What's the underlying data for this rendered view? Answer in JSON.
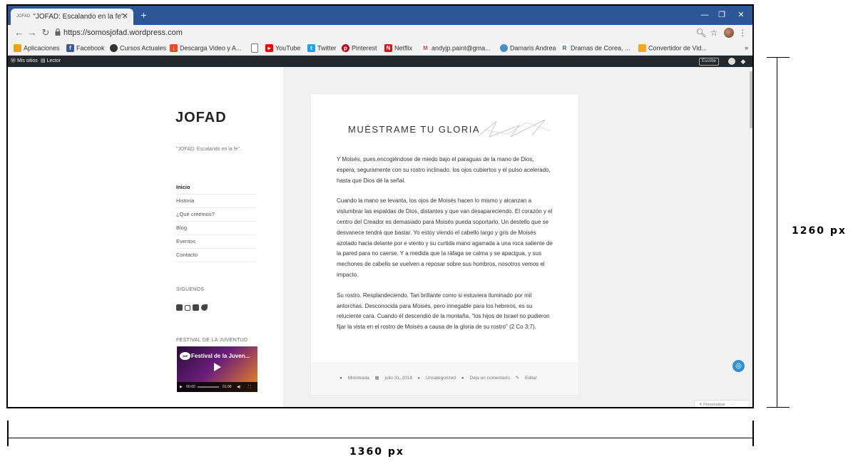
{
  "browser": {
    "tab_title": "\"JOFAD: Escalando en la fe\".",
    "tab_favicon_text": "JOFAD",
    "new_tab_label": "+",
    "url": "https://somosjofad.wordpress.com"
  },
  "bookmarks": [
    {
      "label": "Aplicaciones",
      "color": "#e8a41a",
      "icon": "apps-icon"
    },
    {
      "label": "Facebook",
      "color": "#3b5998",
      "icon": "facebook-icon"
    },
    {
      "label": "Cursos Actuales",
      "color": "#333333",
      "icon": "bookmark-icon"
    },
    {
      "label": "Descarga Video y A...",
      "color": "#e44d26",
      "icon": "download-icon"
    },
    {
      "label": "",
      "color": "#777777",
      "icon": "page-icon"
    },
    {
      "label": "YouTube",
      "color": "#ff0000",
      "icon": "youtube-icon"
    },
    {
      "label": "Twitter",
      "color": "#1da1f2",
      "icon": "twitter-icon"
    },
    {
      "label": "Pinterest",
      "color": "#bd081c",
      "icon": "pinterest-icon"
    },
    {
      "label": "Netflix",
      "color": "#e50914",
      "icon": "netflix-icon"
    },
    {
      "label": "andyjp.paint@gma...",
      "color": "#d44638",
      "icon": "gmail-icon"
    },
    {
      "label": "Damaris Andrea",
      "color": "#4a90c4",
      "icon": "profile-icon"
    },
    {
      "label": "Dramas de Corea, ...",
      "color": "#2b5797",
      "icon": "r-icon"
    },
    {
      "label": "Convertidor de Vid...",
      "color": "#f5a623",
      "icon": "converter-icon"
    }
  ],
  "adminbar": {
    "my_sites": "Mis sitios",
    "reader": "Lector",
    "write": "Escribe"
  },
  "site": {
    "logo": "JOFAD",
    "tagline": "\"JOFAD: Escalando en la fe\"."
  },
  "menu": [
    {
      "label": "Inicio"
    },
    {
      "label": "Historia"
    },
    {
      "label": "¿Qué creemos?"
    },
    {
      "label": "Blog"
    },
    {
      "label": "Eventos"
    },
    {
      "label": "Contacto"
    }
  ],
  "widgets": {
    "follow_title": "SIGUENOS",
    "festival_title": "FESTIVAL DE LA JUVENTUD",
    "video_title": "Festival de la Juven...",
    "video_time_start": "00:00",
    "video_time_end": "01:08"
  },
  "article": {
    "title": "MUÉSTRAME TU GLORIA",
    "paragraphs": [
      "Y Moisés, pues,encogiéndose de miedo bajo el paraguas de la mano de Dios, espera, seguramente con su rostro inclinado, los ojos cubiertos y el pulso acelerado, hasta que Dios dé la señal.",
      "Cuando la mano se levanta, los ojos de Moisés hacen lo mismo y alcanzan a vislumbrar las espaldas de Dios, distantes y que van desapareciendo. El corazón y el centro del Creador es demasiado para Moisés pueda soportarlo. Un destello que se desvanece tendrá que bastar. Yo estoy viendo el cabello largo  y gris de Moisés azotado hacia delante por e viento y su curtida mano agarrada a una roca saliente de la pared para no caerse. Y a medida que la ráfaga se calma y se apacigua, y sus mechones de cabello se vuelven a reposar sobre sus hombros, nosotros vemos el impacto.",
      "Su rostro. Resplandeciendo. Tan brillante como si estuviera iluminado por mil antorchas. Desconocida para Moisés, pero innegable para los hebreos, es su reluciente cara. Cuando él descendió de la montaña, \"los hijos de Israel no pudieron fijar la vista en el rostro de Moisés a causa de la gloria de su rostro\" (2 Co 3:7)."
    ],
    "meta": {
      "author": "Ministrada",
      "date": "julio 31, 2018",
      "category": "Uncategorized",
      "comment": "Deja un comentario",
      "edit": "Editar"
    }
  },
  "customize_label": "Personalizar",
  "dimensions": {
    "height_label": "1260 px",
    "width_label": "1360 px"
  }
}
